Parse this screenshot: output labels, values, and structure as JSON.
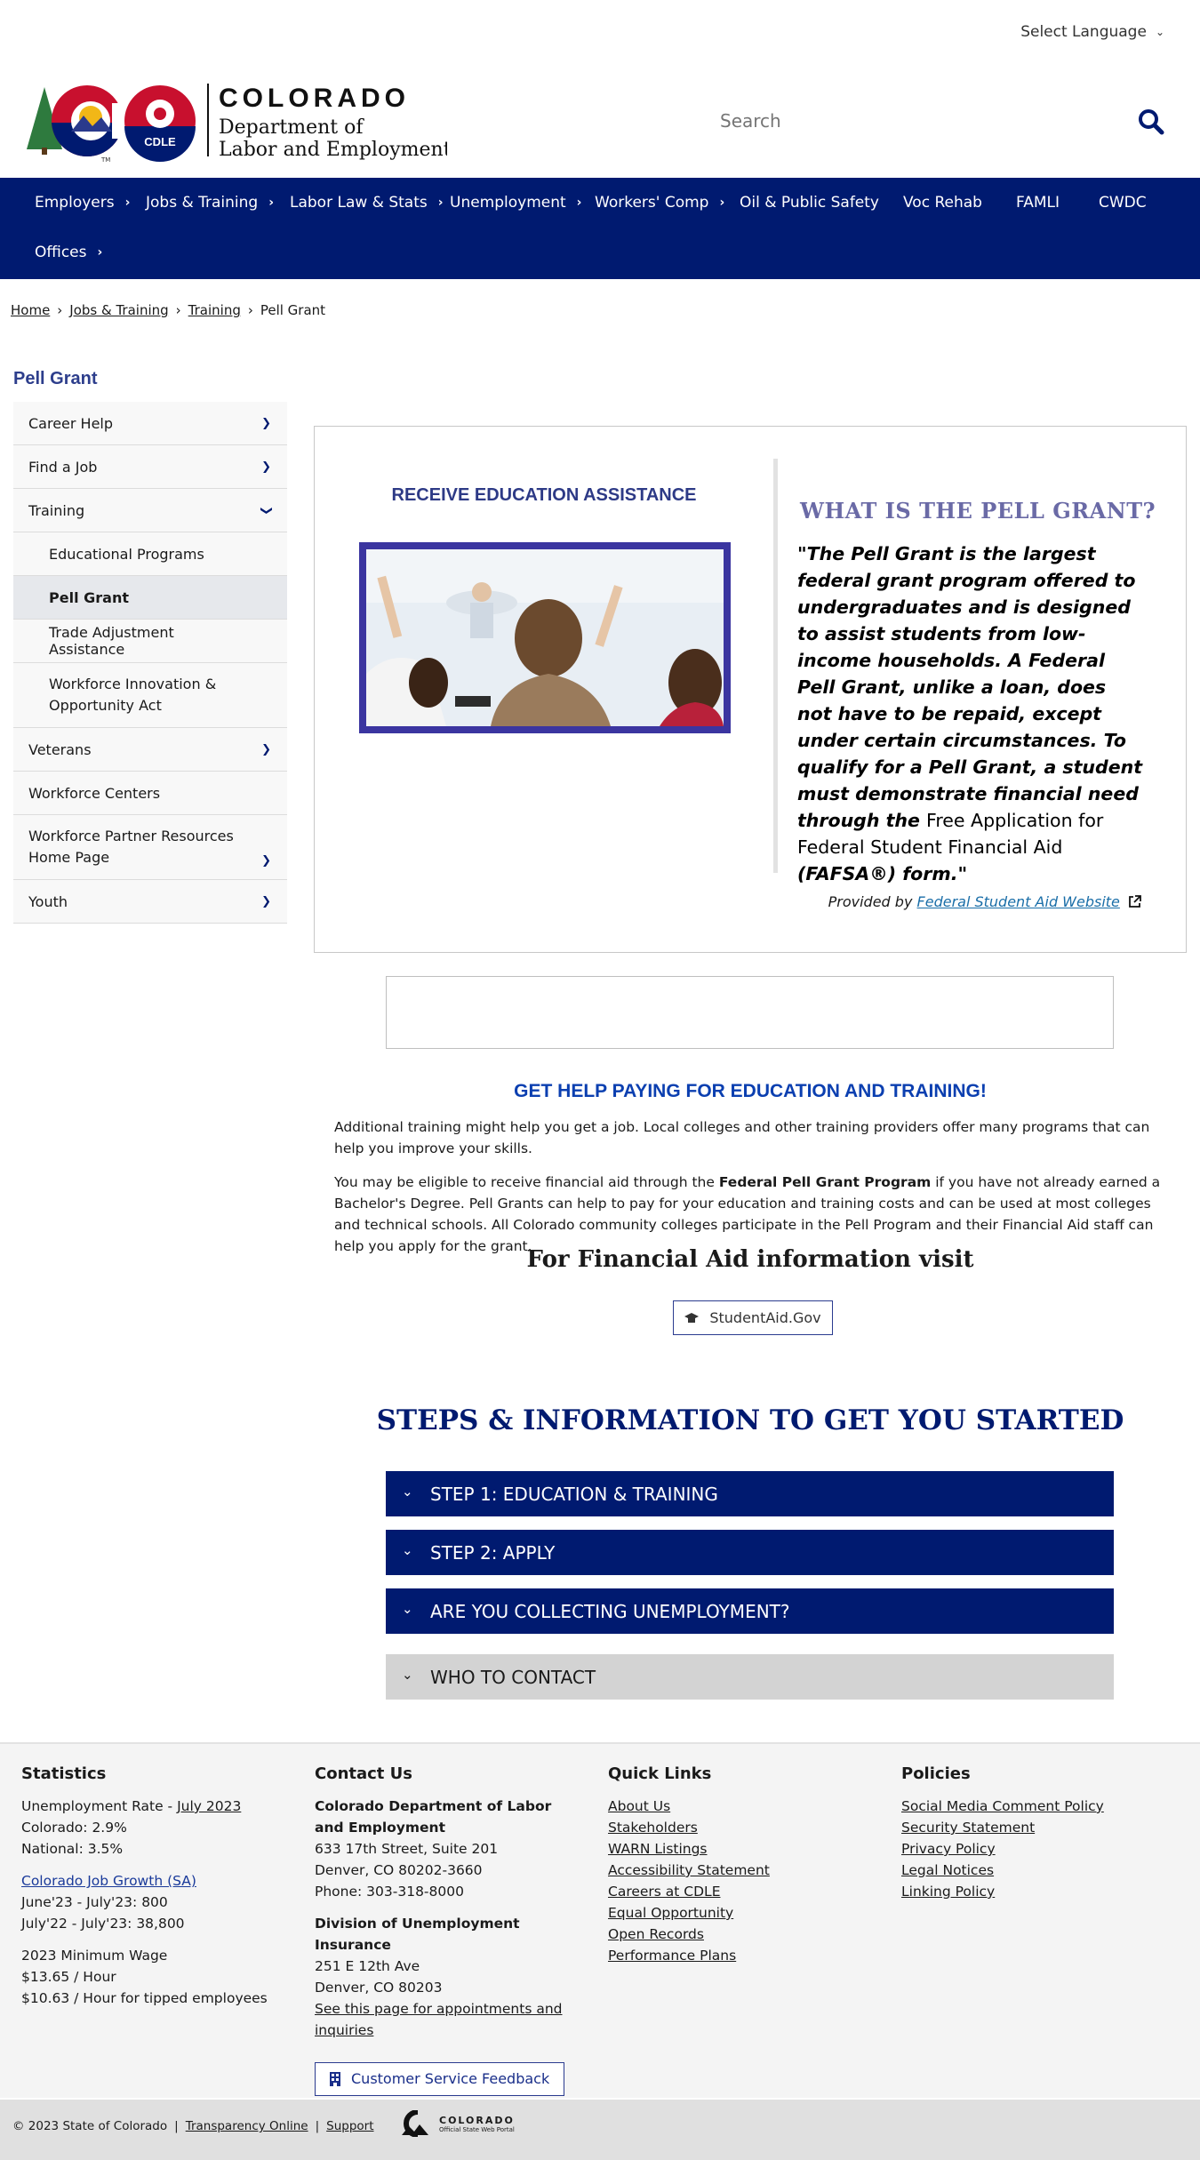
{
  "language": {
    "label": "Select Language"
  },
  "logo": {
    "state": "COLORADO",
    "dept_line1": "Department of",
    "dept_line2": "Labor and Employment",
    "badge": "CDLE",
    "tm": "TM"
  },
  "search": {
    "placeholder": "Search"
  },
  "nav": {
    "items": [
      {
        "label": "Employers",
        "has_sub": true
      },
      {
        "label": "Jobs & Training",
        "has_sub": true
      },
      {
        "label": "Labor Law & Stats",
        "has_sub": true
      },
      {
        "label": "Unemployment",
        "has_sub": true
      },
      {
        "label": "Workers' Comp",
        "has_sub": true
      },
      {
        "label": "Oil & Public Safety",
        "has_sub": false
      },
      {
        "label": "Voc Rehab",
        "has_sub": false
      },
      {
        "label": "FAMLI",
        "has_sub": false
      },
      {
        "label": "CWDC",
        "has_sub": false
      },
      {
        "label": "Offices",
        "has_sub": true
      }
    ]
  },
  "breadcrumb": {
    "home": "Home",
    "jobs": "Jobs & Training",
    "training": "Training",
    "current": "Pell Grant",
    "sep": "›"
  },
  "sidebar": {
    "title": "Pell Grant",
    "items": [
      {
        "label": "Career Help"
      },
      {
        "label": "Find a Job"
      },
      {
        "label": "Training"
      },
      {
        "label": "Educational Programs"
      },
      {
        "label": "Pell Grant"
      },
      {
        "label": "Trade Adjustment Assistance"
      },
      {
        "label": "Workforce Innovation & Opportunity Act"
      },
      {
        "label": "Veterans"
      },
      {
        "label": "Workforce Centers"
      },
      {
        "label": "Workforce Partner Resources Home Page"
      },
      {
        "label": "Youth"
      }
    ]
  },
  "feature": {
    "left_heading": "RECEIVE EDUCATION ASSISTANCE",
    "right_heading": "WHAT IS THE PELL GRANT?",
    "quote_part1": "\"The Pell Grant is the largest federal grant program offered to undergraduates and is designed to assist students from low-income households. A Federal Pell Grant, unlike a loan, does not have to be repaid, except under certain circumstances. To qualify for a Pell Grant, a student must demonstrate financial need through the ",
    "quote_link": "Free Application for Federal Student Financial Aid",
    "quote_part2": " (FAFSA®) form.\"",
    "provided_by": "Provided by ",
    "provided_link": "Federal Student Aid Website"
  },
  "gethelp": {
    "heading": "GET HELP PAYING FOR EDUCATION AND TRAINING!",
    "para1": "Additional training might help you get a job. Local colleges and other training providers offer many programs that can help you improve your skills.",
    "para2_a": "You may be eligible to receive financial aid through the ",
    "para2_bold": "Federal Pell Grant Program",
    "para2_b": " if you have not already earned a Bachelor's Degree. Pell Grants can help to pay for your education and training costs and can be used at most colleges and technical schools. All Colorado community colleges participate in the Pell Program and their Financial Aid staff can help you apply for the grant.",
    "fa_title": "For Financial Aid information visit",
    "button": "StudentAid.Gov"
  },
  "steps": {
    "title": "STEPS & INFORMATION TO GET YOU STARTED",
    "items": [
      {
        "label": "STEP 1: EDUCATION & TRAINING"
      },
      {
        "label": "STEP 2: APPLY"
      },
      {
        "label": "ARE YOU COLLECTING UNEMPLOYMENT?"
      },
      {
        "label": "WHO TO CONTACT"
      }
    ]
  },
  "footer": {
    "stats": {
      "heading": "Statistics",
      "ur_label": "Unemployment Rate - ",
      "ur_link": "July 2023",
      "colorado": "Colorado: 2.9%",
      "national": "National: 3.5%",
      "growth_link": "Colorado Job Growth (SA)",
      "growth1": "June'23 - July'23: 800",
      "growth2": "July'22 - July'23: 38,800",
      "wage_heading": "2023 Minimum Wage",
      "wage1": "$13.65 / Hour",
      "wage2": "$10.63 / Hour for tipped employees"
    },
    "contact": {
      "heading": "Contact Us",
      "org1": "Colorado Department of Labor and Employment",
      "addr1": "633 17th Street, Suite 201",
      "addr2": "Denver, CO  80202-3660",
      "phone": "Phone: 303-318-8000",
      "org2": "Division of Unemployment Insurance",
      "addr3": "251 E 12th Ave",
      "addr4": "Denver, CO  80203",
      "link": "See this page for appointments and inquiries",
      "feedback": "Customer Service Feedback"
    },
    "quick": {
      "heading": "Quick Links",
      "links": [
        "About Us",
        "Stakeholders",
        "WARN Listings",
        "Accessibility Statement",
        "Careers at CDLE",
        "Equal Opportunity",
        "Open Records",
        "Performance Plans"
      ]
    },
    "policies": {
      "heading": "Policies",
      "links": [
        "Social Media Comment Policy",
        "Security Statement",
        "Privacy Policy",
        "Legal Notices",
        "Linking Policy"
      ]
    }
  },
  "bottom": {
    "copyright": "© 2023 State of Colorado",
    "sep": "|",
    "transparency": "Transparency Online",
    "support": "Support",
    "portal_name": "COLORADO",
    "portal_sub": "Official State Web Portal"
  },
  "colors": {
    "nav_bg": "#001a70",
    "accent_blue": "#0b3fb0",
    "photo_border": "#3b35a0"
  }
}
